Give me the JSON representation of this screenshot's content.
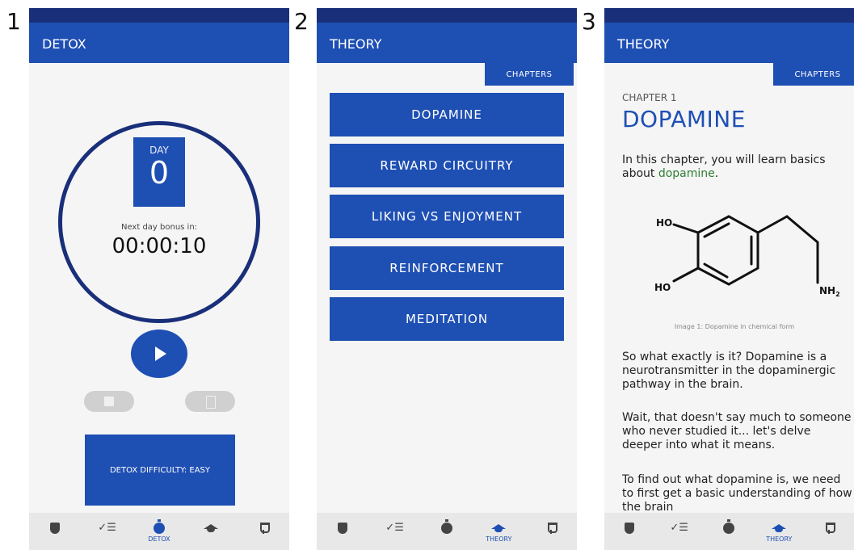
{
  "panels": [
    {
      "number": "1",
      "title": "DETOX",
      "day_label": "DAY",
      "day_value": "0",
      "bonus_label": "Next day bonus in:",
      "timer": "00:00:10",
      "difficulty_label": "DETOX DIFFICULTY: EASY",
      "active_nav": "DETOX"
    },
    {
      "number": "2",
      "title": "THEORY",
      "chapters_tab": "CHAPTERS",
      "chapters": [
        "DOPAMINE",
        "REWARD CIRCUITRY",
        "LIKING VS ENJOYMENT",
        "REINFORCEMENT",
        "MEDITATION"
      ],
      "active_nav": "THEORY"
    },
    {
      "number": "3",
      "title": "THEORY",
      "chapters_tab": "CHAPTERS",
      "chapter_number": "CHAPTER 1",
      "chapter_title": "DOPAMINE",
      "intro_prefix": "In this chapter, you will learn basics about ",
      "intro_link": "dopamine",
      "intro_suffix": ".",
      "molecule_labels": {
        "ho_top": "HO",
        "ho_bottom": "HO",
        "nh2": "NH",
        "nh2_sub": "2"
      },
      "image_caption": "Image 1: Dopamine in chemical form",
      "paragraphs": [
        "So what exactly is it? Dopamine is a neurotransmitter in the dopaminergic pathway in the brain.",
        "Wait, that doesn't say much to someone who never studied it... let's delve deeper into what it means.",
        "To find out what dopamine is, we need to first get a basic understanding of how the brain"
      ],
      "active_nav": "THEORY"
    }
  ],
  "nav_icons": [
    "shield-icon",
    "checklist-icon",
    "timer-icon",
    "graduation-cap-icon",
    "trophy-icon"
  ],
  "colors": {
    "primary": "#1e4fb3",
    "status_bar": "#1a2f7a",
    "link_green": "#2e7d32"
  }
}
